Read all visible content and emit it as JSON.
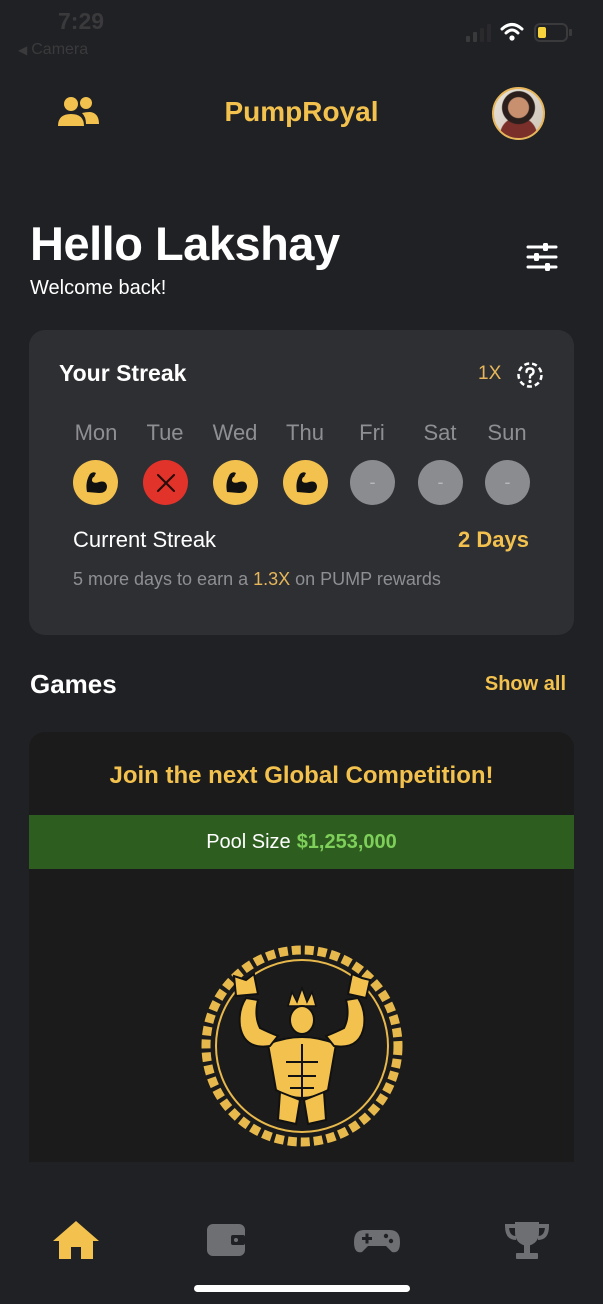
{
  "status_bar": {
    "time": "7:29",
    "back_app": "Camera"
  },
  "header": {
    "title": "PumpRoyal",
    "left_icon": "friends-icon",
    "right_icon": "avatar"
  },
  "greeting": {
    "title": "Hello Lakshay",
    "subtitle": "Welcome back!"
  },
  "streak": {
    "title": "Your Streak",
    "multiplier": "1X",
    "days": [
      {
        "label": "Mon",
        "state": "done",
        "mark": ""
      },
      {
        "label": "Tue",
        "state": "missed",
        "mark": ""
      },
      {
        "label": "Wed",
        "state": "done",
        "mark": ""
      },
      {
        "label": "Thu",
        "state": "done",
        "mark": ""
      },
      {
        "label": "Fri",
        "state": "future",
        "mark": "-"
      },
      {
        "label": "Sat",
        "state": "future",
        "mark": "-"
      },
      {
        "label": "Sun",
        "state": "future",
        "mark": "-"
      }
    ],
    "current_label": "Current Streak",
    "current_value": "2 Days",
    "hint_before": "5 more days to earn a ",
    "hint_highlight": "1.3X",
    "hint_after": " on PUMP rewards"
  },
  "games": {
    "title": "Games",
    "show_all": "Show all",
    "card": {
      "title": "Join the next Global Competition!",
      "pool_label": "Pool Size",
      "pool_amount": "$1,253,000"
    }
  },
  "nav": {
    "items": [
      {
        "icon": "home-icon",
        "active": true
      },
      {
        "icon": "wallet-icon",
        "active": false
      },
      {
        "icon": "gamepad-icon",
        "active": false
      },
      {
        "icon": "trophy-icon",
        "active": false
      }
    ]
  },
  "colors": {
    "background": "#202124",
    "card": "#2e2f33",
    "accent": "#f2c14e",
    "missed": "#e2332b",
    "pool_bar": "#2d5e1f",
    "pool_amount": "#7ed05a",
    "muted": "#8e8f93"
  }
}
